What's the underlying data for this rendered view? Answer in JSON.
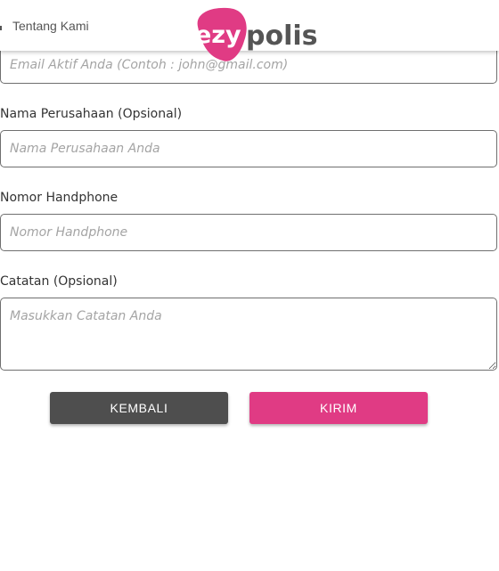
{
  "header": {
    "nav_link": "Tentang Kami",
    "logo": {
      "part1": "ezy",
      "part2": "polis",
      "pink": "#e03b84",
      "gray": "#555555"
    }
  },
  "form": {
    "email": {
      "placeholder": "Email Aktif Anda (Contoh : john@gmail.com)"
    },
    "company": {
      "label": "Nama Perusahaan (Opsional)",
      "placeholder": "Nama Perusahaan Anda"
    },
    "phone": {
      "label": "Nomor Handphone",
      "placeholder": "Nomor Handphone"
    },
    "notes": {
      "label": "Catatan (Opsional)",
      "placeholder": "Masukkan Catatan Anda"
    }
  },
  "buttons": {
    "back": "KEMBALI",
    "submit": "KIRIM"
  },
  "colors": {
    "accent": "#e03b84",
    "back_button": "#4e4e4e"
  }
}
